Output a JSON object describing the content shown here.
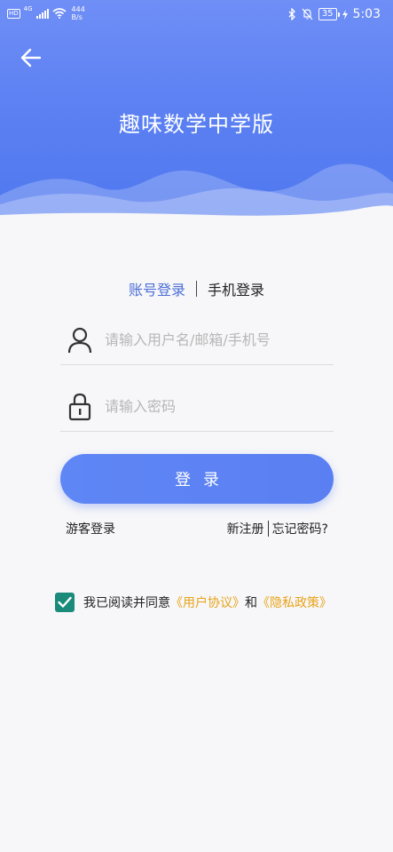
{
  "status_bar": {
    "hd": "HD",
    "network": "4G",
    "speed_value": "444",
    "speed_unit": "B/s",
    "battery": "35",
    "time": "5:03"
  },
  "header": {
    "title": "趣味数学中学版"
  },
  "tabs": {
    "account": "账号登录",
    "phone": "手机登录"
  },
  "form": {
    "username_placeholder": "请输入用户名/邮箱/手机号",
    "username_value": "",
    "password_placeholder": "请输入密码",
    "password_value": "",
    "login_label": "登录"
  },
  "links": {
    "guest": "游客登录",
    "register": "新注册",
    "forgot": "忘记密码?"
  },
  "agreement": {
    "checked": true,
    "prefix": "我已阅读并同意",
    "user_agreement": "《用户协议》",
    "and": "和",
    "privacy_policy": "《隐私政策》"
  },
  "colors": {
    "header": "#5a7ff2",
    "active_tab": "#4d6fd6",
    "checkbox": "#1a8a7b",
    "policy_link": "#e8a317"
  }
}
